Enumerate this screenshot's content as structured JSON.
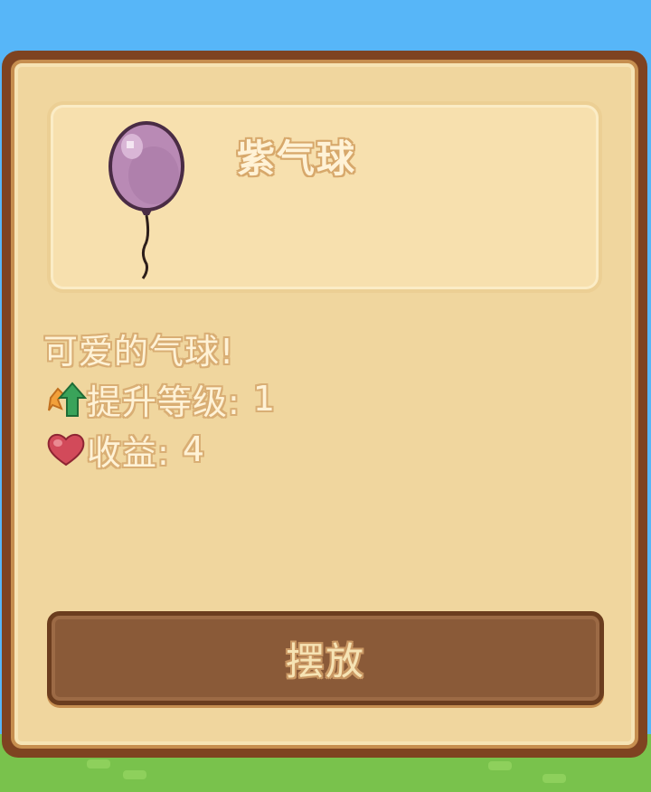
{
  "item": {
    "name": "紫气球",
    "description": "可爱的气球!",
    "icon": "purple-balloon",
    "color": "#b98ab5"
  },
  "stats": {
    "level_label": "提升等级:",
    "level_value": "1",
    "level_icon": "level-up-arrow",
    "income_label": "收益:",
    "income_value": "4",
    "income_icon": "heart",
    "heart_color": "#d24a5a"
  },
  "actions": {
    "place_label": "摆放"
  },
  "colors": {
    "panel_border": "#7e4321",
    "panel_bg": "#f0d69e",
    "button_bg": "#8a5a38",
    "sky": "#57b6f8",
    "grass": "#79c24c"
  }
}
